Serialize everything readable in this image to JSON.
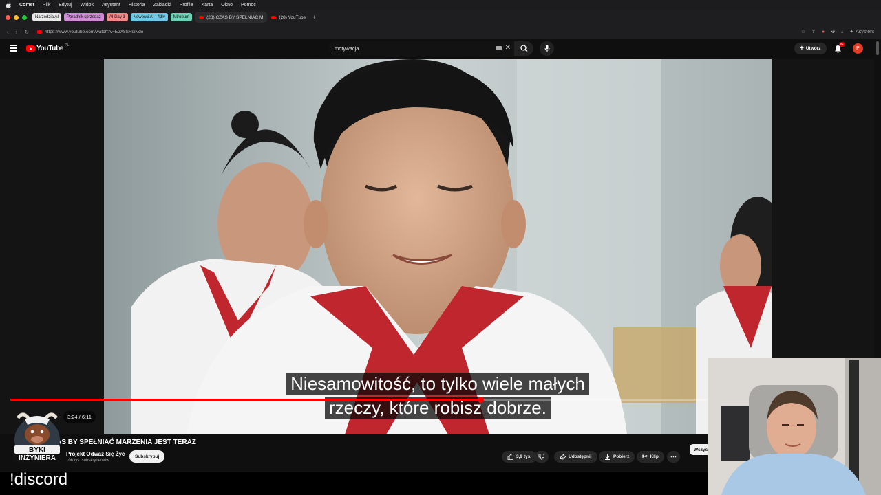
{
  "menubar": {
    "items": [
      "Comet",
      "Plik",
      "Edytuj",
      "Widok",
      "Asystent",
      "Historia",
      "Zakładki",
      "Profile",
      "Karta",
      "Okno",
      "Pomoc"
    ]
  },
  "tabs": {
    "groups": [
      {
        "label": "Narzedzia AI",
        "color": "#e8e8e8"
      },
      {
        "label": "Poradnik sprzedaż",
        "color": "#d08ad6"
      },
      {
        "label": "AI Day 3",
        "color": "#f08a8a"
      },
      {
        "label": "Nowosci AI - 4div",
        "color": "#6fc6e8"
      },
      {
        "label": "Mirobum",
        "color": "#6ed0b4"
      }
    ],
    "active_tab": "(28) CZAS BY SPEŁNIAĆ M",
    "other_tab": "(28) YouTube",
    "new_tab": "+"
  },
  "address": {
    "url": "https://www.youtube.com/watch?v=E2X8SHixNdo",
    "assistant": "Asystent"
  },
  "youtube": {
    "logo": "YouTube",
    "logo_country": "PL",
    "search_value": "motywacja",
    "create_label": "Utwórz",
    "notification_count": "9+",
    "avatar_letter": "P"
  },
  "video": {
    "subtitle_line1": "Niesamowitość, to tylko wiele małych",
    "subtitle_line2": "rzeczy, które robisz dobrze.",
    "time": "3:24 / 6:11",
    "progress": 0.673,
    "title": "ZAS BY SPEŁNIAĆ MARZENIA JEST TERAZ",
    "channel": "Projekt Odważ Się Żyć",
    "subscribers": "106 tys. subskrybentów",
    "subscribe_label": "Subskrybuj",
    "likes": "3,9 tys.",
    "share_label": "Udostępnij",
    "download_label": "Pobierz",
    "clip_label": "Klip",
    "filter_chip": "Wszys"
  },
  "overlay": {
    "discord_text": "!discord",
    "badge_line1": "BYKI",
    "badge_line2": "INŻYNIERA"
  }
}
